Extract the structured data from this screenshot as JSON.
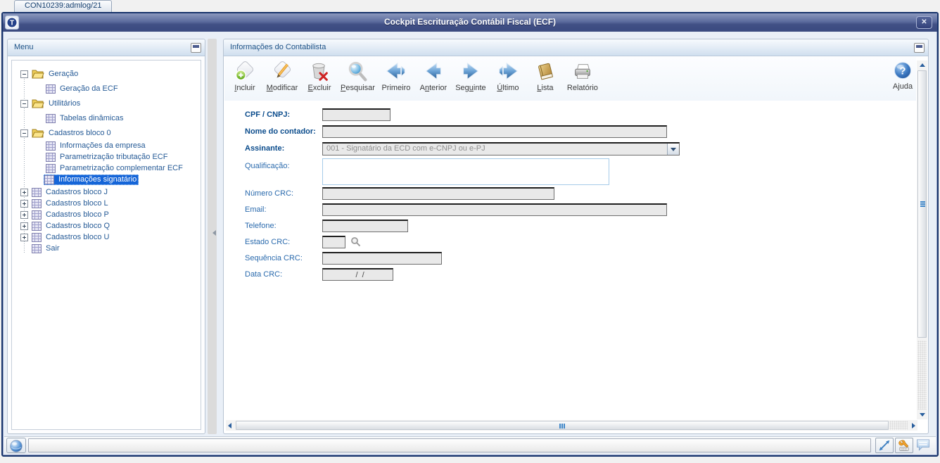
{
  "colors": {
    "titlebar_blue": "#3e4d82",
    "window_border": "#17336b",
    "selection_blue": "#1565d8",
    "panel_header_text": "#1c5186",
    "label_blue": "#2a6aad",
    "label_bold_blue": "#0b4c8c",
    "field_gray": "#e9e9e9"
  },
  "tab": {
    "label": "CON10239:admlog/21"
  },
  "window": {
    "title": "Cockpit Escrituração Contábil Fiscal (ECF)",
    "close": "✕"
  },
  "menu_panel": {
    "title": "Menu",
    "tree": [
      {
        "label": "Geração",
        "icon": "folder",
        "expander": "minus",
        "level": 0
      },
      {
        "label": "Geração da ECF",
        "icon": "grid",
        "expander": "none",
        "level": 1
      },
      {
        "label": "Utilitários",
        "icon": "folder",
        "expander": "minus",
        "level": 0
      },
      {
        "label": "Tabelas dinâmicas",
        "icon": "grid",
        "expander": "none",
        "level": 1
      },
      {
        "label": "Cadastros bloco 0",
        "icon": "folder",
        "expander": "minus",
        "level": 0
      },
      {
        "label": "Informações da empresa",
        "icon": "grid",
        "expander": "none",
        "level": 1
      },
      {
        "label": "Parametrização tributação ECF",
        "icon": "grid",
        "expander": "none",
        "level": 1
      },
      {
        "label": "Parametrização complementar ECF",
        "icon": "grid",
        "expander": "none",
        "level": 1
      },
      {
        "label": "Informações signatário",
        "icon": "grid",
        "expander": "none",
        "level": 1,
        "selected": true
      },
      {
        "label": "Cadastros bloco J",
        "icon": "grid",
        "expander": "plus",
        "level": 0
      },
      {
        "label": "Cadastros bloco L",
        "icon": "grid",
        "expander": "plus",
        "level": 0
      },
      {
        "label": "Cadastros bloco P",
        "icon": "grid",
        "expander": "plus",
        "level": 0
      },
      {
        "label": "Cadastros bloco Q",
        "icon": "grid",
        "expander": "plus",
        "level": 0
      },
      {
        "label": "Cadastros bloco U",
        "icon": "grid",
        "expander": "plus",
        "level": 0
      },
      {
        "label": "Sair",
        "icon": "grid",
        "expander": "none",
        "level": 0
      }
    ]
  },
  "content_panel": {
    "title": "Informações do Contabilista",
    "toolbar": [
      {
        "pre": "",
        "u": "I",
        "post": "ncluir"
      },
      {
        "pre": "",
        "u": "M",
        "post": "odificar"
      },
      {
        "pre": "",
        "u": "E",
        "post": "xcluir"
      },
      {
        "pre": "",
        "u": "P",
        "post": "esquisar"
      },
      {
        "pre": "Primeiro",
        "u": "",
        "post": ""
      },
      {
        "pre": "A",
        "u": "n",
        "post": "terior"
      },
      {
        "pre": "Seg",
        "u": "u",
        "post": "inte"
      },
      {
        "pre": "",
        "u": "Ú",
        "post": "ltimo"
      },
      {
        "pre": "",
        "u": "L",
        "post": "ista"
      },
      {
        "pre": "Relatório",
        "u": "",
        "post": ""
      }
    ],
    "help_label": "Ajuda"
  },
  "form": {
    "cpf": {
      "label": "CPF / CNPJ:",
      "value": ""
    },
    "nome": {
      "label": "Nome do contador:",
      "value": ""
    },
    "assinante": {
      "label": "Assinante:",
      "value": "001 - Signatário da ECD com e-CNPJ ou e-PJ"
    },
    "qualificacao": {
      "label": "Qualificação:",
      "value": ""
    },
    "numero_crc": {
      "label": "Número CRC:",
      "value": ""
    },
    "email": {
      "label": "Email:",
      "value": ""
    },
    "telefone": {
      "label": "Telefone:",
      "value": ""
    },
    "estado_crc": {
      "label": "Estado CRC:",
      "value": ""
    },
    "sequencia_crc": {
      "label": "Sequência CRC:",
      "value": ""
    },
    "data_crc": {
      "label": "Data CRC:",
      "value": "  /  /"
    }
  },
  "status_bar": {
    "icons": [
      "sphere-icon",
      "resize-icon",
      "keyboard-config-icon",
      "chat-icon"
    ]
  }
}
